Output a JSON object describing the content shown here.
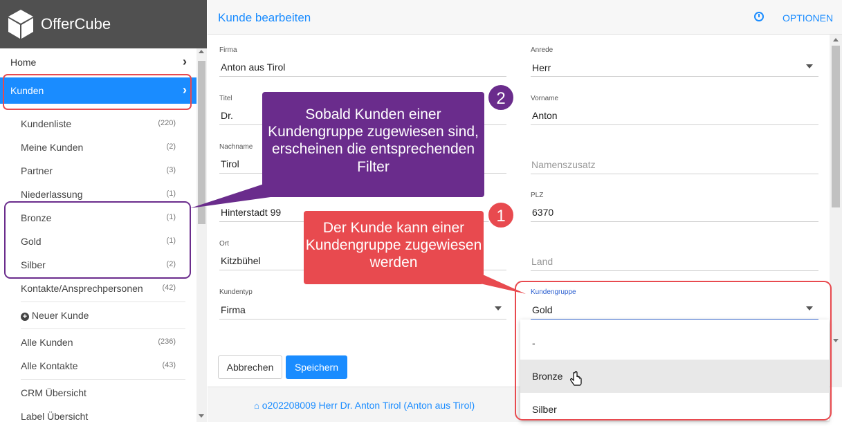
{
  "app": {
    "name": "OfferCube"
  },
  "nav": {
    "home": "Home",
    "kunden": "Kunden"
  },
  "subnav": [
    {
      "label": "Kundenliste",
      "count": "(220)"
    },
    {
      "label": "Meine Kunden",
      "count": "(2)"
    },
    {
      "label": "Partner",
      "count": "(3)"
    },
    {
      "label": "Niederlassung",
      "count": "(1)"
    },
    {
      "label": "Bronze",
      "count": "(1)"
    },
    {
      "label": "Gold",
      "count": "(1)"
    },
    {
      "label": "Silber",
      "count": "(2)"
    },
    {
      "label": "Kontakte/Ansprechpersonen",
      "count": "(42)"
    }
  ],
  "new_customer": "Neuer Kunde",
  "lists": [
    {
      "label": "Alle Kunden",
      "count": "(236)"
    },
    {
      "label": "Alle Kontakte",
      "count": "(43)"
    }
  ],
  "overview": [
    "CRM Übersicht",
    "Label Übersicht"
  ],
  "header": {
    "title": "Kunde bearbeiten",
    "options": "OPTIONEN"
  },
  "form": {
    "firma": {
      "label": "Firma",
      "value": "Anton aus Tirol"
    },
    "anrede": {
      "label": "Anrede",
      "value": "Herr"
    },
    "titel": {
      "label": "Titel",
      "value": "Dr."
    },
    "vorname": {
      "label": "Vorname",
      "value": "Anton"
    },
    "nachname": {
      "label": "Nachname",
      "value": "Tirol"
    },
    "namenszusatz": {
      "placeholder": "Namenszusatz"
    },
    "strasse": {
      "value": "Hinterstadt 99"
    },
    "plz": {
      "label": "PLZ",
      "value": "6370"
    },
    "ort": {
      "label": "Ort",
      "value": "Kitzbühel"
    },
    "land": {
      "placeholder": "Land"
    },
    "kundentyp": {
      "label": "Kundentyp",
      "value": "Firma"
    },
    "kundengruppe": {
      "label": "Kundengruppe",
      "value": "Gold"
    }
  },
  "dropdown_options": [
    "-",
    "Bronze",
    "Silber"
  ],
  "buttons": {
    "cancel": "Abbrechen",
    "save": "Speichern"
  },
  "footer": {
    "text": "o202208009 Herr Dr. Anton Tirol (Anton aus Tirol)"
  },
  "annotations": {
    "callout1": "Der Kunde kann einer Kundengruppe zugewiesen werden",
    "callout2": "Sobald Kunden einer Kundengruppe zugewiesen sind, erscheinen die entsprechenden Filter",
    "badge1": "1",
    "badge2": "2"
  },
  "colors": {
    "accent": "#1a8cff",
    "highlight_red": "#e84a4f",
    "highlight_purple": "#6a2c8c"
  }
}
